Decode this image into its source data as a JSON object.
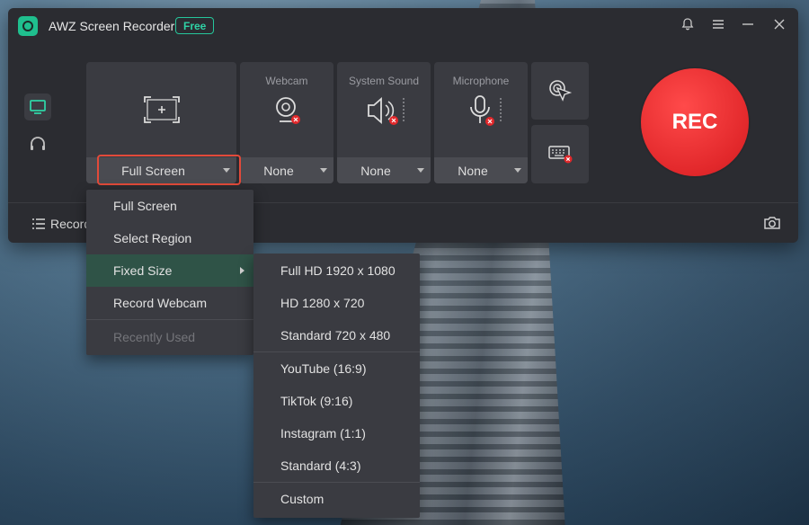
{
  "desktop": {
    "description_colors": {
      "sky": "#4c6f88"
    }
  },
  "window": {
    "title": "AWZ Screen Recorder",
    "badge": "Free",
    "accent": "#26c69b",
    "icons": [
      "bell-icon",
      "hamburger-menu-icon",
      "minimize-icon",
      "close-icon"
    ]
  },
  "sidebar": {
    "items": [
      {
        "icon": "monitor-icon",
        "active": true
      },
      {
        "icon": "headphones-icon",
        "active": false
      }
    ]
  },
  "panels": {
    "screen": {
      "value": "Full Screen",
      "icon": "screen-region-icon"
    },
    "webcam": {
      "label": "Webcam",
      "value": "None",
      "icon": "webcam-disabled-icon"
    },
    "system_sound": {
      "label": "System Sound",
      "value": "None",
      "icon": "speaker-disabled-icon"
    },
    "microphone": {
      "label": "Microphone",
      "value": "None",
      "icon": "microphone-disabled-icon"
    },
    "cursor": {
      "icon": "cursor-click-icon"
    },
    "keyboard": {
      "icon": "keyboard-disabled-icon"
    }
  },
  "rec_button": {
    "label": "REC",
    "color": "#e2282b"
  },
  "footer": {
    "records_label": "Records",
    "camera_icon": "camera-icon"
  },
  "screen_menu": {
    "items": [
      {
        "label": "Full Screen"
      },
      {
        "label": "Select Region"
      },
      {
        "label": "Fixed Size",
        "has_submenu": true,
        "active": true
      },
      {
        "label": "Record Webcam"
      },
      {
        "label": "Recently Used",
        "disabled": true
      }
    ]
  },
  "fixed_size_submenu": {
    "items": [
      {
        "label": "Full HD 1920 x 1080"
      },
      {
        "label": "HD 1280 x 720"
      },
      {
        "label": "Standard 720 x 480"
      },
      {
        "label": "YouTube (16:9)"
      },
      {
        "label": "TikTok (9:16)"
      },
      {
        "label": "Instagram (1:1)"
      },
      {
        "label": "Standard (4:3)"
      },
      {
        "label": "Custom"
      }
    ]
  }
}
